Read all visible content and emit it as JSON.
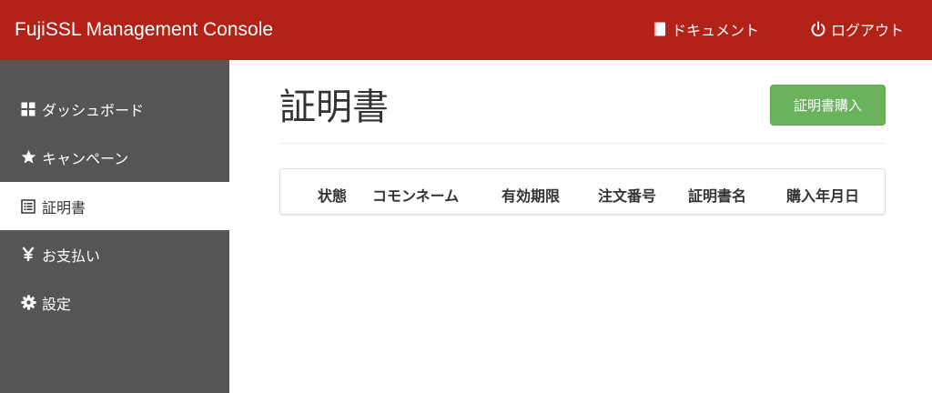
{
  "header": {
    "brand": "FujiSSL Management Console",
    "docs_label": "ドキュメント",
    "logout_label": "ログアウト",
    "background_color": "#b22217"
  },
  "sidebar": {
    "background_color": "#555555",
    "items": [
      {
        "label": "ダッシュボード",
        "icon": "dashboard-grid-icon",
        "active": false
      },
      {
        "label": "キャンペーン",
        "icon": "star-icon",
        "active": false
      },
      {
        "label": "証明書",
        "icon": "list-document-icon",
        "active": true
      },
      {
        "label": "お支払い",
        "icon": "yen-icon",
        "active": false
      },
      {
        "label": "設定",
        "icon": "gear-icon",
        "active": false
      }
    ]
  },
  "main": {
    "title": "証明書",
    "buy_button_label": "証明書購入",
    "buy_button_color": "#6bb25c",
    "table": {
      "columns": [
        "状態",
        "コモンネーム",
        "有効期限",
        "注文番号",
        "証明書名",
        "購入年月日"
      ],
      "rows": []
    }
  }
}
